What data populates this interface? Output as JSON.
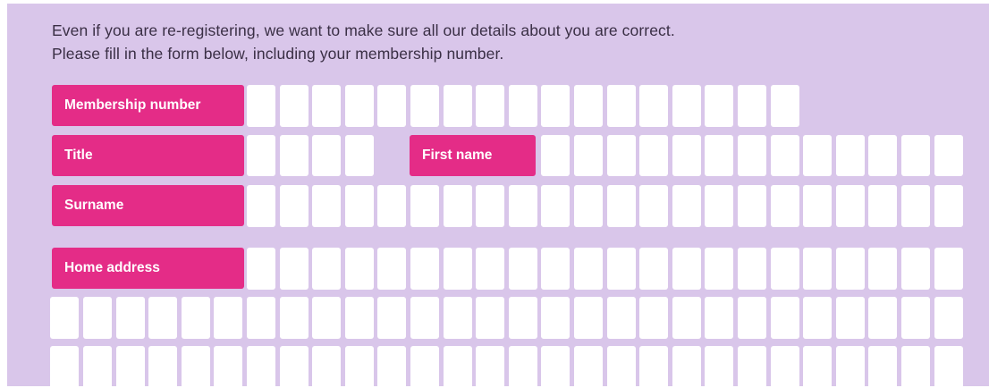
{
  "form": {
    "intro_line_1": "Even if you are re-registering, we want to make sure all our details about you are correct.",
    "intro_line_2": "Please fill in the form below, including your membership number.",
    "label_color": "#e42c87",
    "background_color": "#d9c6ea",
    "fields": {
      "membership_number": "Membership number",
      "title": "Title",
      "first_name": "First name",
      "surname": "Surname",
      "home_address": "Home address"
    }
  }
}
